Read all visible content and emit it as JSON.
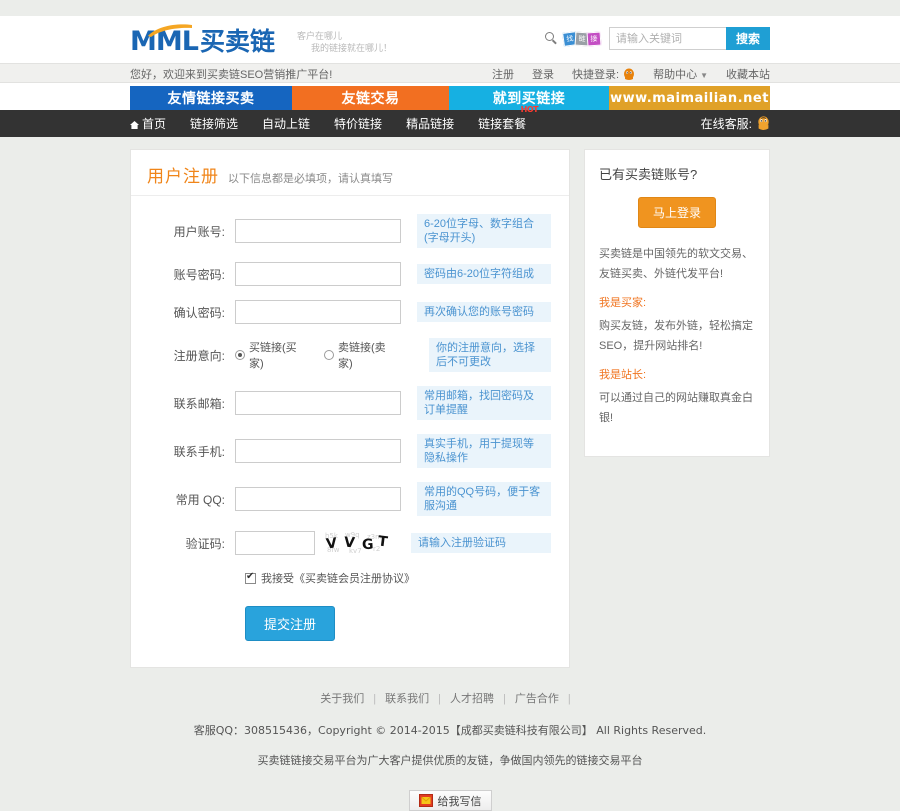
{
  "header": {
    "logo_latin": "MML",
    "logo_cn": "买卖链",
    "tagline_line1": "客户在哪儿",
    "tagline_line2": "我的链接就在哪儿！",
    "tiles": [
      "找",
      "链",
      "接"
    ],
    "search": {
      "placeholder": "请输入关键词",
      "value": "",
      "button": "搜索"
    }
  },
  "userbar": {
    "welcome": "您好，欢迎来到买卖链SEO营销推广平台!",
    "register": "注册",
    "login": "登录",
    "quick_login": "快捷登录:",
    "help": "帮助中心",
    "favorite": "收藏本站"
  },
  "banner": [
    {
      "text": "友情链接买卖",
      "color": "#1565c0"
    },
    {
      "text": "友链交易",
      "color": "#f26f21"
    },
    {
      "text": "就到买链接",
      "color": "#16b0e2"
    },
    {
      "text": "www.maimailian.net",
      "color": "#e0a128"
    }
  ],
  "nav": {
    "items": [
      {
        "label": "首页",
        "icon": "home-icon",
        "badge": ""
      },
      {
        "label": "链接筛选",
        "icon": "",
        "badge": ""
      },
      {
        "label": "自动上链",
        "icon": "",
        "badge": ""
      },
      {
        "label": "特价链接",
        "icon": "",
        "badge": ""
      },
      {
        "label": "精品链接",
        "icon": "",
        "badge": ""
      },
      {
        "label": "链接套餐",
        "icon": "",
        "badge": "HOT"
      }
    ],
    "service_label": "在线客服:"
  },
  "form": {
    "title": "用户注册",
    "subtitle": "以下信息都是必填项，请认真填写",
    "fields": [
      {
        "label": "用户账号:",
        "value": "",
        "hint": "6-20位字母、数字组合(字母开头)"
      },
      {
        "label": "账号密码:",
        "value": "",
        "hint": "密码由6-20位字符组成"
      },
      {
        "label": "确认密码:",
        "value": "",
        "hint": "再次确认您的账号密码"
      }
    ],
    "intent": {
      "label": "注册意向:",
      "options": [
        {
          "text": "买链接(买家)",
          "selected": true
        },
        {
          "text": "卖链接(卖家)",
          "selected": false
        }
      ],
      "hint": "你的注册意向，选择后不可更改"
    },
    "fields2": [
      {
        "label": "联系邮箱:",
        "value": "",
        "hint": "常用邮箱，找回密码及订单提醒"
      },
      {
        "label": "联系手机:",
        "value": "",
        "hint": "真实手机，用于提现等隐私操作"
      },
      {
        "label": "常用 QQ:",
        "value": "",
        "hint": "常用的QQ号码，便于客服沟通"
      }
    ],
    "captcha": {
      "label": "验证码:",
      "value": "",
      "image_text": "VVGT",
      "hint": "请输入注册验证码"
    },
    "agree": {
      "checked": true,
      "text": "我接受《买卖链会员注册协议》"
    },
    "submit": "提交注册"
  },
  "sidebar": {
    "title": "已有买卖链账号?",
    "login_button": "马上登录",
    "intro": "买卖链是中国领先的软文交易、友链买卖、外链代发平台!",
    "buyer_heading": "我是买家:",
    "buyer_text": "购买友链，发布外链，轻松搞定SEO，提升网站排名!",
    "webmaster_heading": "我是站长:",
    "webmaster_text": "可以通过自己的网站赚取真金白银!"
  },
  "footer": {
    "links": [
      "关于我们",
      "联系我们",
      "人才招聘",
      "广告合作"
    ],
    "copyright": "客服QQ：308515436，Copyright © 2014-2015【成都买卖链科技有限公司】 All Rights Reserved.",
    "slogan": "买卖链链接交易平台为广大客户提供优质的友链，争做国内领先的链接交易平台",
    "mailbox": "给我写信"
  }
}
